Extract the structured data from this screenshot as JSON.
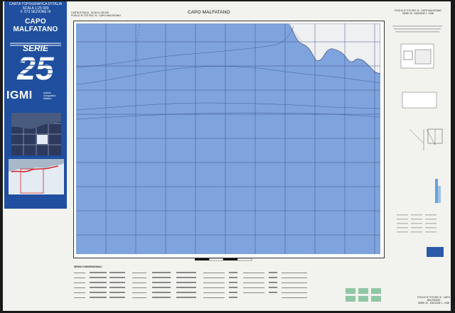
{
  "cover": {
    "header_lines": [
      "CARTA TOPOGRAFICA D'ITALIA",
      "SCALA 1:25 000",
      "F. 573 SEZIONE III"
    ],
    "title": "CAPO MALFATANO",
    "serie_label": "SERIE",
    "serie_number": "25",
    "agency_short": "IGMI",
    "agency_full": [
      "Istituto",
      "Geografico",
      "Militare"
    ]
  },
  "map": {
    "title": "CAPO MALFATANO",
    "head_left": [
      "CARTA D'ITALIA - SCALA 1:25 000",
      "FOGLIO N° 573 SEZ. III - CAPO MALFATANO"
    ],
    "sea_color": "#7fa3dc",
    "land_color": "#e9ecef",
    "grid_color": "#44518a"
  },
  "legend": {
    "title": "SEGNI CONVENZIONALI"
  },
  "right_panel": {
    "top_lines": [
      "FOGLIO N° 573 SEZ. III - CAPO MALFATANO",
      "SERIE 25 - EDIZIONE 1 - IGMI"
    ]
  },
  "sheet_id": [
    "FOGLIO N° 573 SEZ. III - CAPO MALFATANO",
    "SERIE 25 - EDIZIONE 1 - IGMI"
  ]
}
